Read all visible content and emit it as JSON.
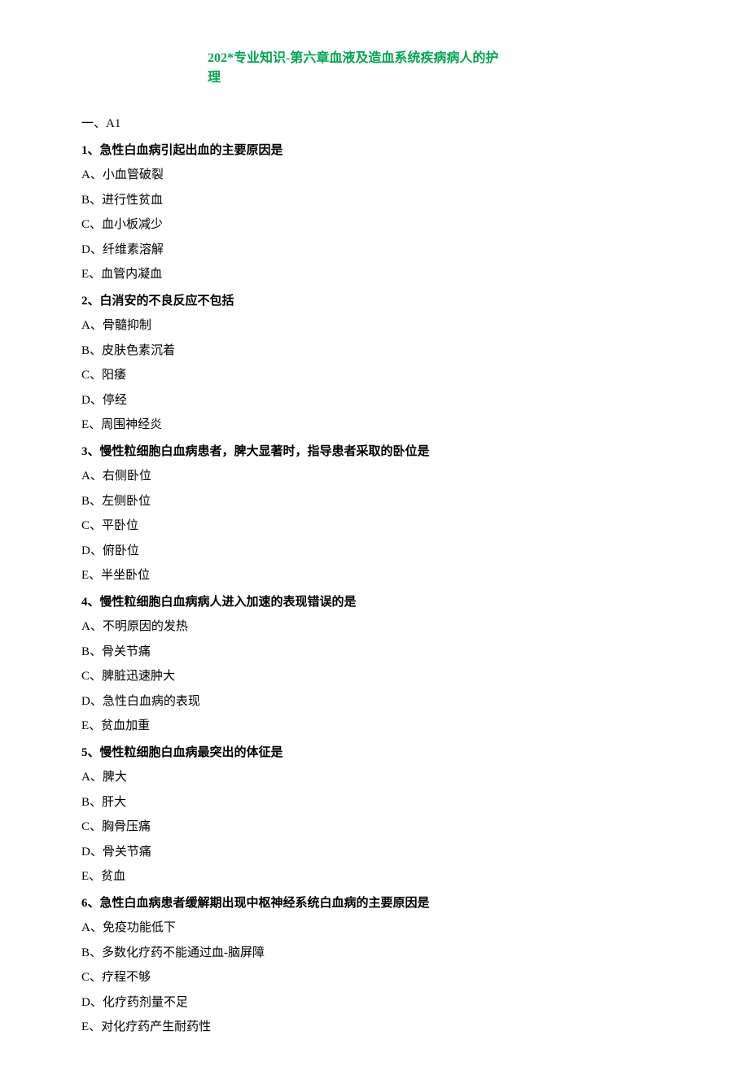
{
  "title": "202*专业知识-第六章血液及造血系统疾病病人的护理",
  "section_label": "一、A1",
  "questions": [
    {
      "number": "1、",
      "text": "急性白血病引起出血的主要原因是",
      "options": [
        "A、小血管破裂",
        "B、进行性贫血",
        "C、血小板减少",
        "D、纤维素溶解",
        "E、血管内凝血"
      ]
    },
    {
      "number": "2、",
      "text": "白消安的不良反应不包括",
      "options": [
        "A、骨髓抑制",
        "B、皮肤色素沉着",
        "C、阳痿",
        "D、停经",
        "E、周围神经炎"
      ]
    },
    {
      "number": "3、",
      "text": "慢性粒细胞白血病患者，脾大显著时，指导患者采取的卧位是",
      "options": [
        "A、右侧卧位",
        "B、左侧卧位",
        "C、平卧位",
        "D、俯卧位",
        "E、半坐卧位"
      ]
    },
    {
      "number": "4、",
      "text": "慢性粒细胞白血病病人进入加速的表现错误的是",
      "options": [
        "A、不明原因的发热",
        "B、骨关节痛",
        "C、脾脏迅速肿大",
        "D、急性白血病的表现",
        "E、贫血加重"
      ]
    },
    {
      "number": "5、",
      "text": "慢性粒细胞白血病最突出的体征是",
      "options": [
        "A、脾大",
        "B、肝大",
        "C、胸骨压痛",
        "D、骨关节痛",
        "E、贫血"
      ]
    },
    {
      "number": "6、",
      "text": "急性白血病患者缓解期出现中枢神经系统白血病的主要原因是",
      "options": [
        "A、免疫功能低下",
        "B、多数化疗药不能通过血-脑屏障",
        "C、疗程不够",
        "D、化疗药剂量不足",
        "E、对化疗药产生耐药性"
      ]
    }
  ]
}
